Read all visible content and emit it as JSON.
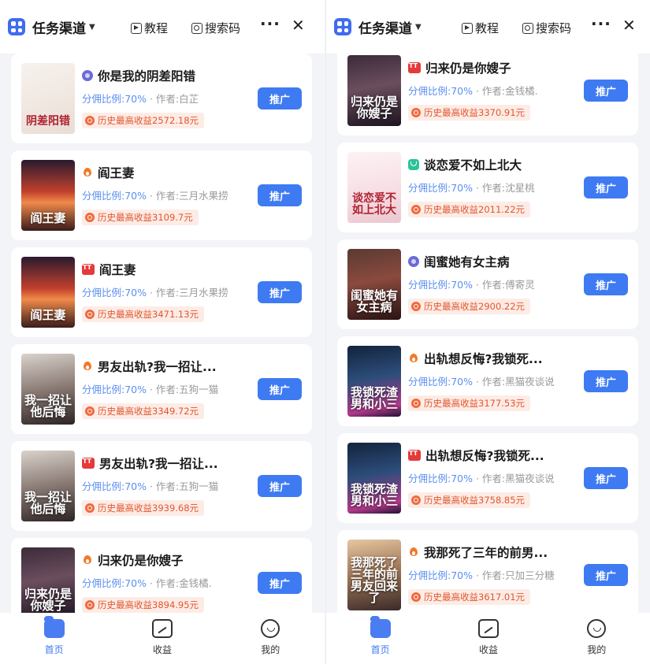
{
  "header": {
    "channel": "任务渠道",
    "tutorial": "教程",
    "search_code": "搜索码",
    "more": "···",
    "close": "✕"
  },
  "labels": {
    "promote": "推广"
  },
  "left": {
    "cards": [
      {
        "title": "你是我的阴差阳错",
        "platform": "circle",
        "rate": "分佣比例:70%",
        "author": "· 作者:白芷",
        "earn": "历史最高收益2572.18元",
        "cover_text": "阴差阳错",
        "cover_theme": "light"
      },
      {
        "title": "阎王妻",
        "platform": "flame",
        "rate": "分佣比例:70%",
        "author": "· 作者:三月水果捞",
        "earn": "历史最高收益3109.7元",
        "cover_text": "阎王妻",
        "cover_theme": "sunset"
      },
      {
        "title": "阎王妻",
        "platform": "red",
        "rate": "分佣比例:70%",
        "author": "· 作者:三月水果捞",
        "earn": "历史最高收益3471.13元",
        "cover_text": "阎王妻",
        "cover_theme": "sunset"
      },
      {
        "title": "男友出轨?我一招让...",
        "platform": "flame",
        "rate": "分佣比例:70%",
        "author": "· 作者:五狗一猫",
        "earn": "历史最高收益3349.72元",
        "cover_text": "我一招让他后悔",
        "cover_theme": "couple"
      },
      {
        "title": "男友出轨?我一招让...",
        "platform": "red",
        "rate": "分佣比例:70%",
        "author": "· 作者:五狗一猫",
        "earn": "历史最高收益3939.68元",
        "cover_text": "我一招让他后悔",
        "cover_theme": "couple"
      },
      {
        "title": "归来仍是你嫂子",
        "platform": "flame",
        "rate": "分佣比例:70%",
        "author": "· 作者:金钱橘.",
        "earn": "历史最高收益3894.95元",
        "cover_text": "归来仍是你嫂子",
        "cover_theme": "night"
      }
    ]
  },
  "right": {
    "cards": [
      {
        "title": "归来仍是你嫂子",
        "platform": "red",
        "rate": "分佣比例:70%",
        "author": "· 作者:金钱橘.",
        "earn": "历史最高收益3370.91元",
        "cover_text": "归来仍是你嫂子",
        "cover_theme": "night"
      },
      {
        "title": "谈恋爱不如上北大",
        "platform": "green",
        "rate": "分佣比例:70%",
        "author": "· 作者:沈星桃",
        "earn": "历史最高收益2011.22元",
        "cover_text": "谈恋爱不如上北大",
        "cover_theme": "pink"
      },
      {
        "title": "闺蜜她有女主病",
        "platform": "circle",
        "rate": "分佣比例:70%",
        "author": "· 作者:傅寄灵",
        "earn": "历史最高收益2900.22元",
        "cover_text": "闺蜜她有女主病",
        "cover_theme": "rose"
      },
      {
        "title": "出轨想反悔?我锁死...",
        "platform": "flame",
        "rate": "分佣比例:70%",
        "author": "· 作者:黑猫夜谈说",
        "earn": "历史最高收益3177.53元",
        "cover_text": "我锁死渣男和小三",
        "cover_theme": "neon"
      },
      {
        "title": "出轨想反悔?我锁死...",
        "platform": "red",
        "rate": "分佣比例:70%",
        "author": "· 作者:黑猫夜谈说",
        "earn": "历史最高收益3758.85元",
        "cover_text": "我锁死渣男和小三",
        "cover_theme": "neon"
      },
      {
        "title": "我那死了三年的前男...",
        "platform": "flame",
        "rate": "分佣比例:70%",
        "author": "· 作者:只加三分糖",
        "earn": "历史最高收益3617.01元",
        "cover_text": "我那死了三年的前男友回来了",
        "cover_theme": "blonde"
      }
    ]
  },
  "tabs": [
    {
      "label": "首页",
      "icon": "home-icon",
      "active": true
    },
    {
      "label": "收益",
      "icon": "earnings-chart-icon",
      "active": false
    },
    {
      "label": "我的",
      "icon": "profile-smile-icon",
      "active": false
    }
  ],
  "colors": {
    "accent": "#3e7af2",
    "earn_text": "#e2562e",
    "earn_bg": "#fdece6",
    "rate_text": "#5b8ff0"
  }
}
